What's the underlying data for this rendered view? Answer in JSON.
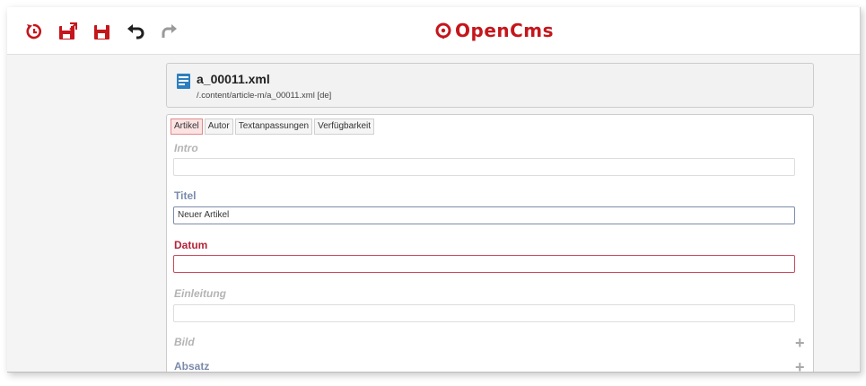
{
  "toolbar": {
    "buttons": [
      {
        "name": "reset-icon"
      },
      {
        "name": "save-exit-icon"
      },
      {
        "name": "save-icon"
      },
      {
        "name": "undo-icon"
      },
      {
        "name": "redo-icon"
      }
    ],
    "logo_text": "OpenCms",
    "accent_color": "#c4161c"
  },
  "file": {
    "name": "a_00011.xml",
    "path": "/.content/article-m/a_00011.xml [de]"
  },
  "tabs": [
    {
      "label": "Artikel",
      "active": true
    },
    {
      "label": "Autor",
      "active": false
    },
    {
      "label": "Textanpassungen",
      "active": false
    },
    {
      "label": "Verfügbarkeit",
      "active": false
    }
  ],
  "fields": {
    "intro": {
      "label": "Intro",
      "value": ""
    },
    "titel": {
      "label": "Titel",
      "value": "Neuer Artikel"
    },
    "datum": {
      "label": "Datum",
      "value": ""
    },
    "einleitung": {
      "label": "Einleitung",
      "value": ""
    },
    "bild": {
      "label": "Bild"
    },
    "absatz": {
      "label": "Absatz"
    }
  }
}
